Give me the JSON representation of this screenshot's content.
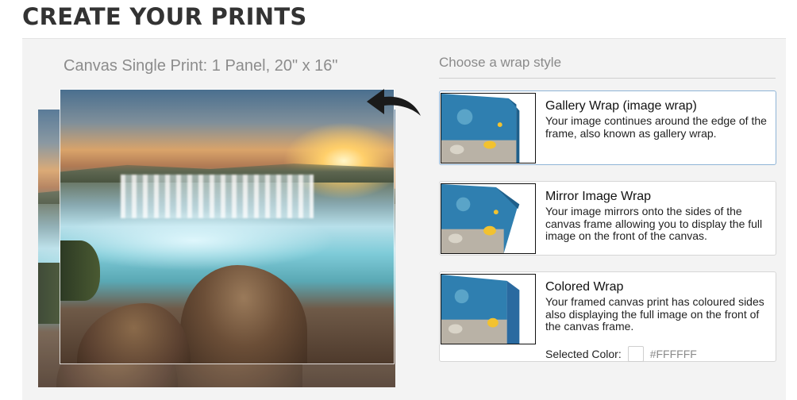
{
  "page": {
    "title": "CREATE YOUR PRINTS"
  },
  "preview": {
    "title": "Canvas Single Print: 1 Panel, 20\" x 16\"",
    "icons": {
      "back": "curved-back-arrow-icon"
    }
  },
  "wrap_section": {
    "heading": "Choose a wrap style",
    "selected_index": 0,
    "options": [
      {
        "title": "Gallery Wrap (image wrap)",
        "description": "Your image continues around the edge of the frame, also known as gallery wrap."
      },
      {
        "title": "Mirror Image Wrap",
        "description": "Your image mirrors onto the sides of the canvas frame allowing you to display the full image on the front of the canvas."
      },
      {
        "title": "Colored Wrap",
        "description": "Your framed canvas print has coloured sides also displaying the full image on the front of the canvas frame.",
        "selected_color_label": "Selected Color:",
        "selected_color_value": "#FFFFFF"
      }
    ]
  },
  "colors": {
    "selected_border": "#8fb4d6",
    "panel_background": "#f3f3f3"
  }
}
